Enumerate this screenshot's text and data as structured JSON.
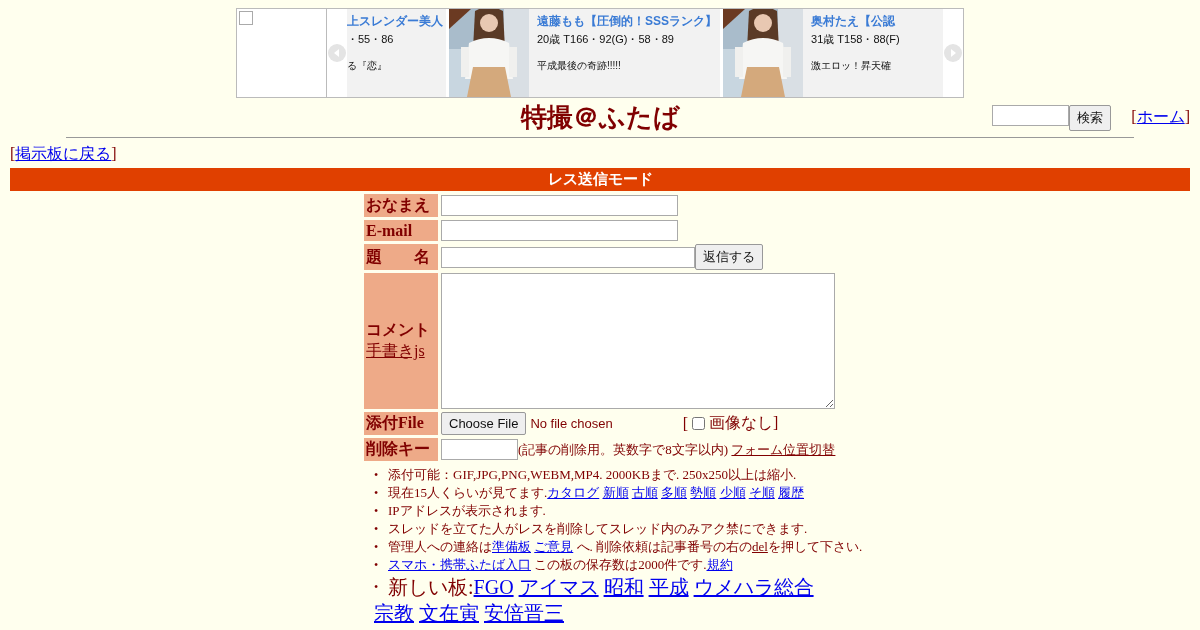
{
  "banner": {
    "slides": [
      {
        "picture": false,
        "name": "上スレンダー美人",
        "stats": "・55・86",
        "caption": "る『恋』"
      },
      {
        "picture": true,
        "name": "遠藤もも【圧倒的！SSSランク】",
        "stats": "20歳 T166・92(G)・58・89",
        "caption": "平成最後の奇跡!!!!!"
      },
      {
        "picture": true,
        "name": "奥村たえ【公認",
        "stats": "31歳 T158・88(F)",
        "caption": "激エロッ！昇天確"
      }
    ]
  },
  "header": {
    "title": "特撮＠ふたば",
    "search_button": "検索",
    "home": {
      "left": "[",
      "label": "ホーム",
      "right": "]"
    }
  },
  "back": {
    "left": "[",
    "label": "掲示板に戻る",
    "right": "]"
  },
  "mode_bar": "レス送信モード",
  "form": {
    "name_label": "おなまえ",
    "email_label": "E-mail",
    "subject_label": "題　　名",
    "submit": "返信する",
    "comment_label": "コメント",
    "comment_link": "手書きjs",
    "file_label": "添付File",
    "file_button": "Choose File",
    "file_status": "No file chosen",
    "no_image": {
      "left": "[",
      "label": "画像なし]",
      "checked": false
    },
    "delkey_label": "削除キー",
    "delkey_hint": "(記事の削除用。英数字で8文字以内)",
    "position_link": "フォーム位置切替"
  },
  "notes": [
    {
      "kind": "small",
      "bullet": "•",
      "parts": [
        {
          "kind": "text",
          "text": "添付可能：GIF,JPG,PNG,WEBM,MP4. 2000KBまで. 250x250以上は縮小."
        }
      ]
    },
    {
      "kind": "small",
      "bullet": "•",
      "parts": [
        {
          "kind": "text",
          "text": "現在15人くらいが見てます."
        },
        {
          "kind": "link",
          "text": "カタログ"
        },
        {
          "kind": "link",
          "text": "新順"
        },
        {
          "kind": "link",
          "text": "古順"
        },
        {
          "kind": "link",
          "text": "多順"
        },
        {
          "kind": "link",
          "text": "勢順"
        },
        {
          "kind": "link",
          "text": "少順"
        },
        {
          "kind": "link",
          "text": "そ順"
        },
        {
          "kind": "link",
          "text": "履歴"
        }
      ]
    },
    {
      "kind": "small",
      "bullet": "•",
      "parts": [
        {
          "kind": "text",
          "text": "IPアドレスが表示されます."
        }
      ]
    },
    {
      "kind": "small",
      "bullet": "•",
      "parts": [
        {
          "kind": "text",
          "text": "スレッドを立てた人がレスを削除してスレッド内のみアク禁にできます."
        }
      ]
    },
    {
      "kind": "small",
      "bullet": "•",
      "parts": [
        {
          "kind": "text",
          "text": "管理人への連絡は"
        },
        {
          "kind": "link",
          "text": "準備板"
        },
        {
          "kind": "link",
          "text": "ご意見"
        },
        {
          "kind": "text",
          "text": "へ. 削除依頼は記事番号の右の"
        },
        {
          "kind": "dellink",
          "text": "del"
        },
        {
          "kind": "text",
          "text": "を押して下さい."
        }
      ]
    },
    {
      "kind": "small",
      "bullet": "•",
      "parts": [
        {
          "kind": "link",
          "text": "スマホ・携帯ふたば入口"
        },
        {
          "kind": "text",
          "text": "この板の保存数は2000件です."
        },
        {
          "kind": "link",
          "text": "規約"
        }
      ]
    },
    {
      "kind": "large",
      "bullet": "•",
      "parts": [
        {
          "kind": "text",
          "text": "新しい板:"
        },
        {
          "kind": "link",
          "text": "FGO"
        },
        {
          "kind": "link",
          "text": "アイマス"
        },
        {
          "kind": "link",
          "text": "昭和"
        },
        {
          "kind": "link",
          "text": "平成"
        },
        {
          "kind": "link",
          "text": "ウメハラ総合"
        },
        {
          "kind": "link",
          "text": "宗教"
        },
        {
          "kind": "link",
          "text": "文在寅"
        },
        {
          "kind": "link",
          "text": "安倍晋三"
        }
      ]
    }
  ]
}
